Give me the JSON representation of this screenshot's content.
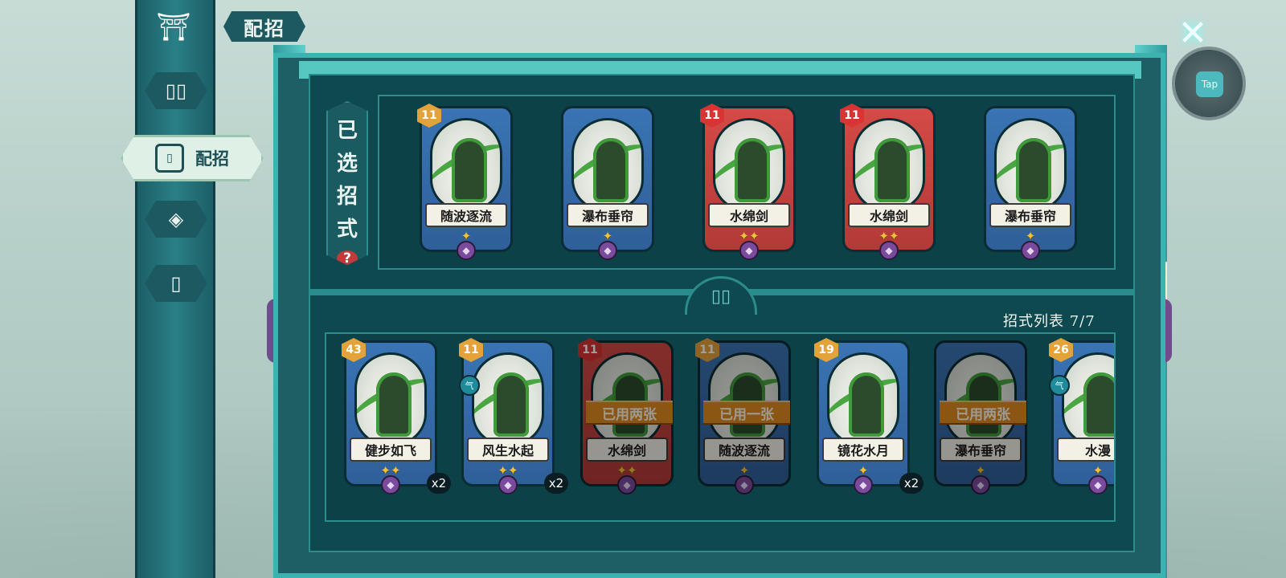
{
  "title": "配招",
  "sidebar": {
    "items": [
      {
        "name": "home",
        "icon": "temple-icon"
      },
      {
        "name": "cards",
        "icon": "cards-icon"
      },
      {
        "name": "loadout",
        "icon": "loadout-icon",
        "label": "配招",
        "active": true
      },
      {
        "name": "skills",
        "icon": "emblem-icon"
      },
      {
        "name": "cardbook",
        "icon": "card-icon"
      }
    ]
  },
  "tap_label": "Tap",
  "selected": {
    "label_chars": [
      "已",
      "选",
      "招",
      "式"
    ],
    "help": "?",
    "cards": [
      {
        "name": "随波逐流",
        "cost": "11",
        "color": "blue",
        "stars": "✦"
      },
      {
        "name": "瀑布垂帘",
        "cost": "",
        "color": "blue",
        "stars": "✦"
      },
      {
        "name": "水绵剑",
        "cost": "11",
        "color": "red",
        "stars": "✦✦"
      },
      {
        "name": "水绵剑",
        "cost": "11",
        "color": "red",
        "stars": "✦✦"
      },
      {
        "name": "瀑布垂帘",
        "cost": "",
        "color": "blue",
        "stars": "✦"
      }
    ]
  },
  "list": {
    "title": "招式列表 7/7",
    "cards": [
      {
        "name": "健步如飞",
        "cost": "43",
        "color": "blue",
        "stars": "✦✦",
        "count": "x2",
        "used": "",
        "qi": ""
      },
      {
        "name": "风生水起",
        "cost": "11",
        "color": "blue",
        "stars": "✦✦",
        "count": "x2",
        "used": "",
        "qi": "气"
      },
      {
        "name": "水绵剑",
        "cost": "11",
        "color": "red",
        "stars": "✦✦",
        "count": "",
        "used": "已用两张",
        "qi": ""
      },
      {
        "name": "随波逐流",
        "cost": "11",
        "color": "blue",
        "stars": "✦",
        "count": "",
        "used": "已用一张",
        "qi": ""
      },
      {
        "name": "镜花水月",
        "cost": "19",
        "color": "blue",
        "stars": "✦",
        "count": "x2",
        "used": "",
        "qi": ""
      },
      {
        "name": "瀑布垂帘",
        "cost": "",
        "color": "blue",
        "stars": "✦",
        "count": "",
        "used": "已用两张",
        "qi": ""
      },
      {
        "name": "水漫",
        "cost": "26",
        "color": "blue",
        "stars": "✦",
        "count": "",
        "used": "",
        "qi": "气"
      }
    ]
  },
  "colors": {
    "panel": "#1e5f66",
    "accent": "#3bb3b0",
    "card_blue": "#3a74b4",
    "card_red": "#d44a46",
    "used_tag": "#e08a1e"
  }
}
